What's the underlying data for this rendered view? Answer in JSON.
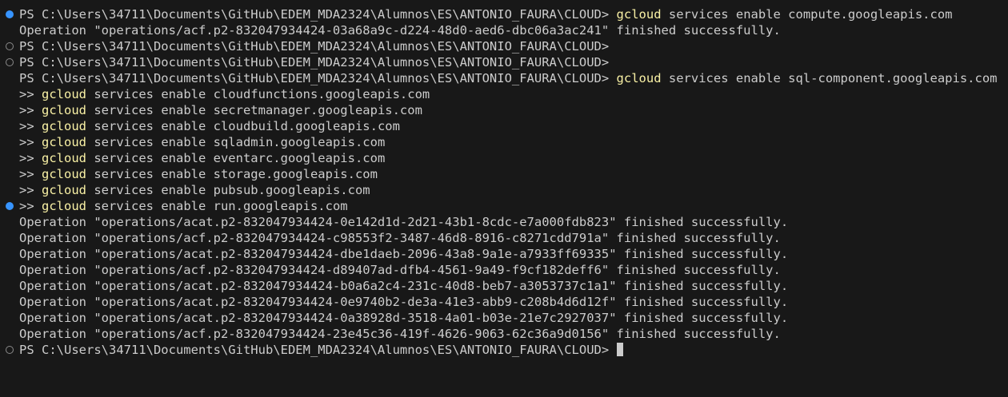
{
  "terminal": {
    "background": "#181818",
    "foreground": "#cccccc",
    "command_color": "#f9f1a5",
    "decoration_success_color": "#3794ff",
    "decoration_empty_color": "#8a8a8a",
    "lines": [
      {
        "deco": "success",
        "parts": [
          {
            "t": "PS C:\\Users\\34711\\Documents\\GitHub\\EDEM_MDA2324\\Alumnos\\ES\\ANTONIO_FAURA\\CLOUD> "
          },
          {
            "t": "gcloud",
            "c": "cmd"
          },
          {
            "t": " services enable compute.googleapis.com"
          }
        ]
      },
      {
        "deco": "none",
        "parts": [
          {
            "t": "Operation \"operations/acf.p2-832047934424-03a68a9c-d224-48d0-aed6-dbc06a3ac241\" finished successfully."
          }
        ]
      },
      {
        "deco": "empty",
        "parts": [
          {
            "t": "PS C:\\Users\\34711\\Documents\\GitHub\\EDEM_MDA2324\\Alumnos\\ES\\ANTONIO_FAURA\\CLOUD>"
          }
        ]
      },
      {
        "deco": "empty",
        "parts": [
          {
            "t": "PS C:\\Users\\34711\\Documents\\GitHub\\EDEM_MDA2324\\Alumnos\\ES\\ANTONIO_FAURA\\CLOUD>"
          }
        ]
      },
      {
        "deco": "none",
        "parts": [
          {
            "t": "PS C:\\Users\\34711\\Documents\\GitHub\\EDEM_MDA2324\\Alumnos\\ES\\ANTONIO_FAURA\\CLOUD> "
          },
          {
            "t": "gcloud",
            "c": "cmd"
          },
          {
            "t": " services enable sql-component.googleapis.com"
          }
        ]
      },
      {
        "deco": "none",
        "parts": [
          {
            "t": ">> "
          },
          {
            "t": "gcloud",
            "c": "cmd"
          },
          {
            "t": " services enable cloudfunctions.googleapis.com"
          }
        ]
      },
      {
        "deco": "none",
        "parts": [
          {
            "t": ">> "
          },
          {
            "t": "gcloud",
            "c": "cmd"
          },
          {
            "t": " services enable secretmanager.googleapis.com"
          }
        ]
      },
      {
        "deco": "none",
        "parts": [
          {
            "t": ">> "
          },
          {
            "t": "gcloud",
            "c": "cmd"
          },
          {
            "t": " services enable cloudbuild.googleapis.com"
          }
        ]
      },
      {
        "deco": "none",
        "parts": [
          {
            "t": ">> "
          },
          {
            "t": "gcloud",
            "c": "cmd"
          },
          {
            "t": " services enable sqladmin.googleapis.com"
          }
        ]
      },
      {
        "deco": "none",
        "parts": [
          {
            "t": ">> "
          },
          {
            "t": "gcloud",
            "c": "cmd"
          },
          {
            "t": " services enable eventarc.googleapis.com"
          }
        ]
      },
      {
        "deco": "none",
        "parts": [
          {
            "t": ">> "
          },
          {
            "t": "gcloud",
            "c": "cmd"
          },
          {
            "t": " services enable storage.googleapis.com"
          }
        ]
      },
      {
        "deco": "none",
        "parts": [
          {
            "t": ">> "
          },
          {
            "t": "gcloud",
            "c": "cmd"
          },
          {
            "t": " services enable pubsub.googleapis.com"
          }
        ]
      },
      {
        "deco": "success",
        "parts": [
          {
            "t": ">> "
          },
          {
            "t": "gcloud",
            "c": "cmd"
          },
          {
            "t": " services enable run.googleapis.com"
          }
        ]
      },
      {
        "deco": "none",
        "parts": [
          {
            "t": "Operation \"operations/acat.p2-832047934424-0e142d1d-2d21-43b1-8cdc-e7a000fdb823\" finished successfully."
          }
        ]
      },
      {
        "deco": "none",
        "parts": [
          {
            "t": "Operation \"operations/acf.p2-832047934424-c98553f2-3487-46d8-8916-c8271cdd791a\" finished successfully."
          }
        ]
      },
      {
        "deco": "none",
        "parts": [
          {
            "t": "Operation \"operations/acat.p2-832047934424-dbe1daeb-2096-43a8-9a1e-a7933ff69335\" finished successfully."
          }
        ]
      },
      {
        "deco": "none",
        "parts": [
          {
            "t": "Operation \"operations/acf.p2-832047934424-d89407ad-dfb4-4561-9a49-f9cf182deff6\" finished successfully."
          }
        ]
      },
      {
        "deco": "none",
        "parts": [
          {
            "t": "Operation \"operations/acat.p2-832047934424-b0a6a2c4-231c-40d8-beb7-a3053737c1a1\" finished successfully."
          }
        ]
      },
      {
        "deco": "none",
        "parts": [
          {
            "t": "Operation \"operations/acat.p2-832047934424-0e9740b2-de3a-41e3-abb9-c208b4d6d12f\" finished successfully."
          }
        ]
      },
      {
        "deco": "none",
        "parts": [
          {
            "t": "Operation \"operations/acat.p2-832047934424-0a38928d-3518-4a01-b03e-21e7c2927037\" finished successfully."
          }
        ]
      },
      {
        "deco": "none",
        "parts": [
          {
            "t": "Operation \"operations/acf.p2-832047934424-23e45c36-419f-4626-9063-62c36a9d0156\" finished successfully."
          }
        ]
      },
      {
        "deco": "empty",
        "cursor": true,
        "parts": [
          {
            "t": "PS C:\\Users\\34711\\Documents\\GitHub\\EDEM_MDA2324\\Alumnos\\ES\\ANTONIO_FAURA\\CLOUD> "
          }
        ]
      }
    ]
  }
}
